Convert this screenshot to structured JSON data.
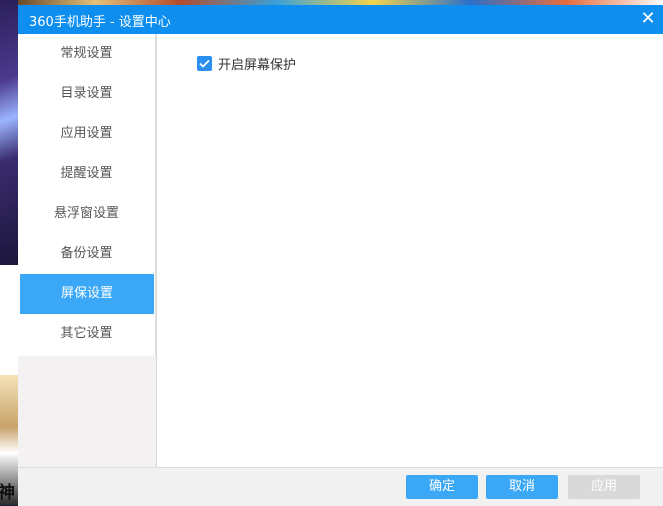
{
  "window": {
    "title": "360手机助手 - 设置中心",
    "close_glyph": "✕"
  },
  "sidebar": {
    "items": [
      {
        "label": "常规设置",
        "active": false
      },
      {
        "label": "目录设置",
        "active": false
      },
      {
        "label": "应用设置",
        "active": false
      },
      {
        "label": "提醒设置",
        "active": false
      },
      {
        "label": "悬浮窗设置",
        "active": false
      },
      {
        "label": "备份设置",
        "active": false
      },
      {
        "label": "屏保设置",
        "active": true
      },
      {
        "label": "其它设置",
        "active": false
      }
    ]
  },
  "main": {
    "screensaver_option": {
      "label": "开启屏幕保护",
      "checked": true
    }
  },
  "footer": {
    "ok_label": "确定",
    "cancel_label": "取消",
    "apply_label": "应用"
  },
  "background": {
    "partial_glyph": "神"
  },
  "colors": {
    "titlebar": "#0e8ff0",
    "accent": "#3aa8f6",
    "disabled": "#d9d9d9"
  }
}
